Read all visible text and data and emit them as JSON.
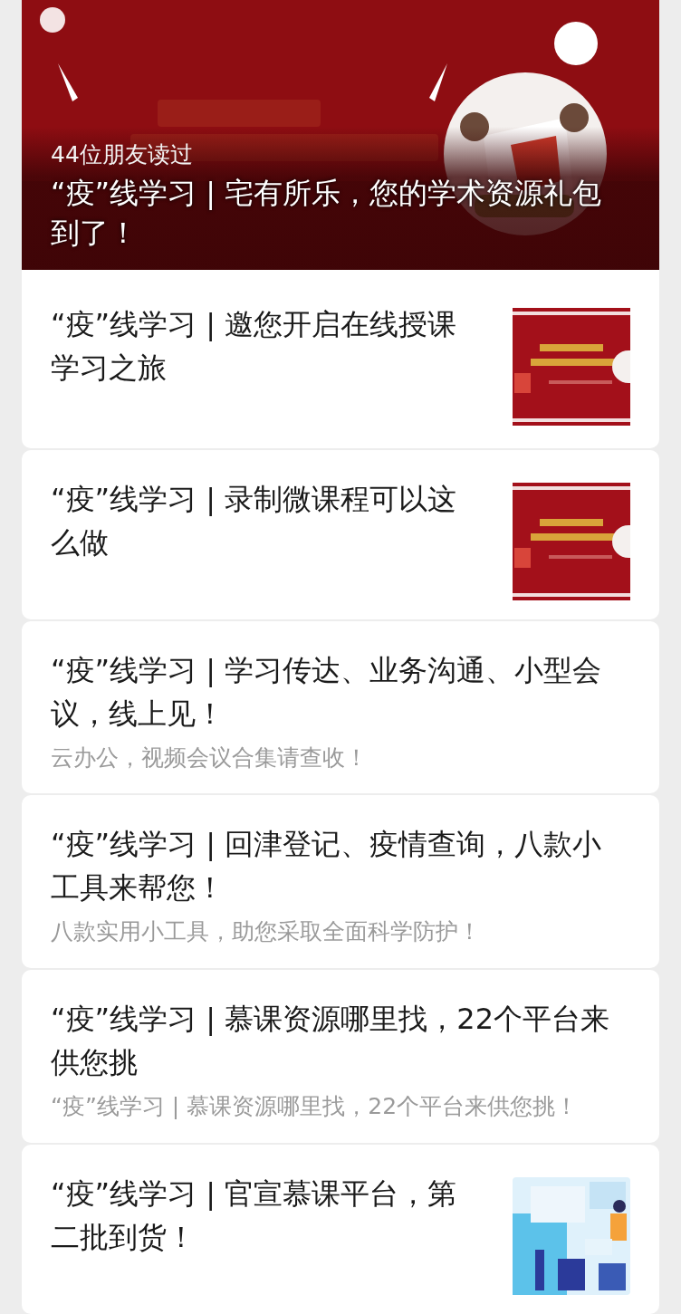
{
  "featured": {
    "read_count": "44位朋友读过",
    "title": "“疫”线学习 | 宅有所乐，您的学术资源礼包到了！"
  },
  "articles": [
    {
      "kind": "thumb",
      "title": "“疫”线学习 | 邀您开启在线授课学习之旅"
    },
    {
      "kind": "thumb",
      "title": "“疫”线学习 | 录制微课程可以这么做"
    },
    {
      "kind": "text",
      "title": "“疫”线学习 | 学习传达、业务沟通、小型会议，线上见！",
      "digest": "云办公，视频会议合集请查收！"
    },
    {
      "kind": "text",
      "title": "“疫”线学习 | 回津登记、疫情查询，八款小工具来帮您！",
      "digest": "八款实用小工具，助您采取全面科学防护！"
    },
    {
      "kind": "text",
      "title": "“疫”线学习 | 慕课资源哪里找，22个平台来供您挑",
      "digest": "“疫”线学习 | 慕课资源哪里找，22个平台来供您挑！"
    },
    {
      "kind": "thumb",
      "title": "“疫”线学习 | 官宣慕课平台，第二批到货！"
    }
  ]
}
